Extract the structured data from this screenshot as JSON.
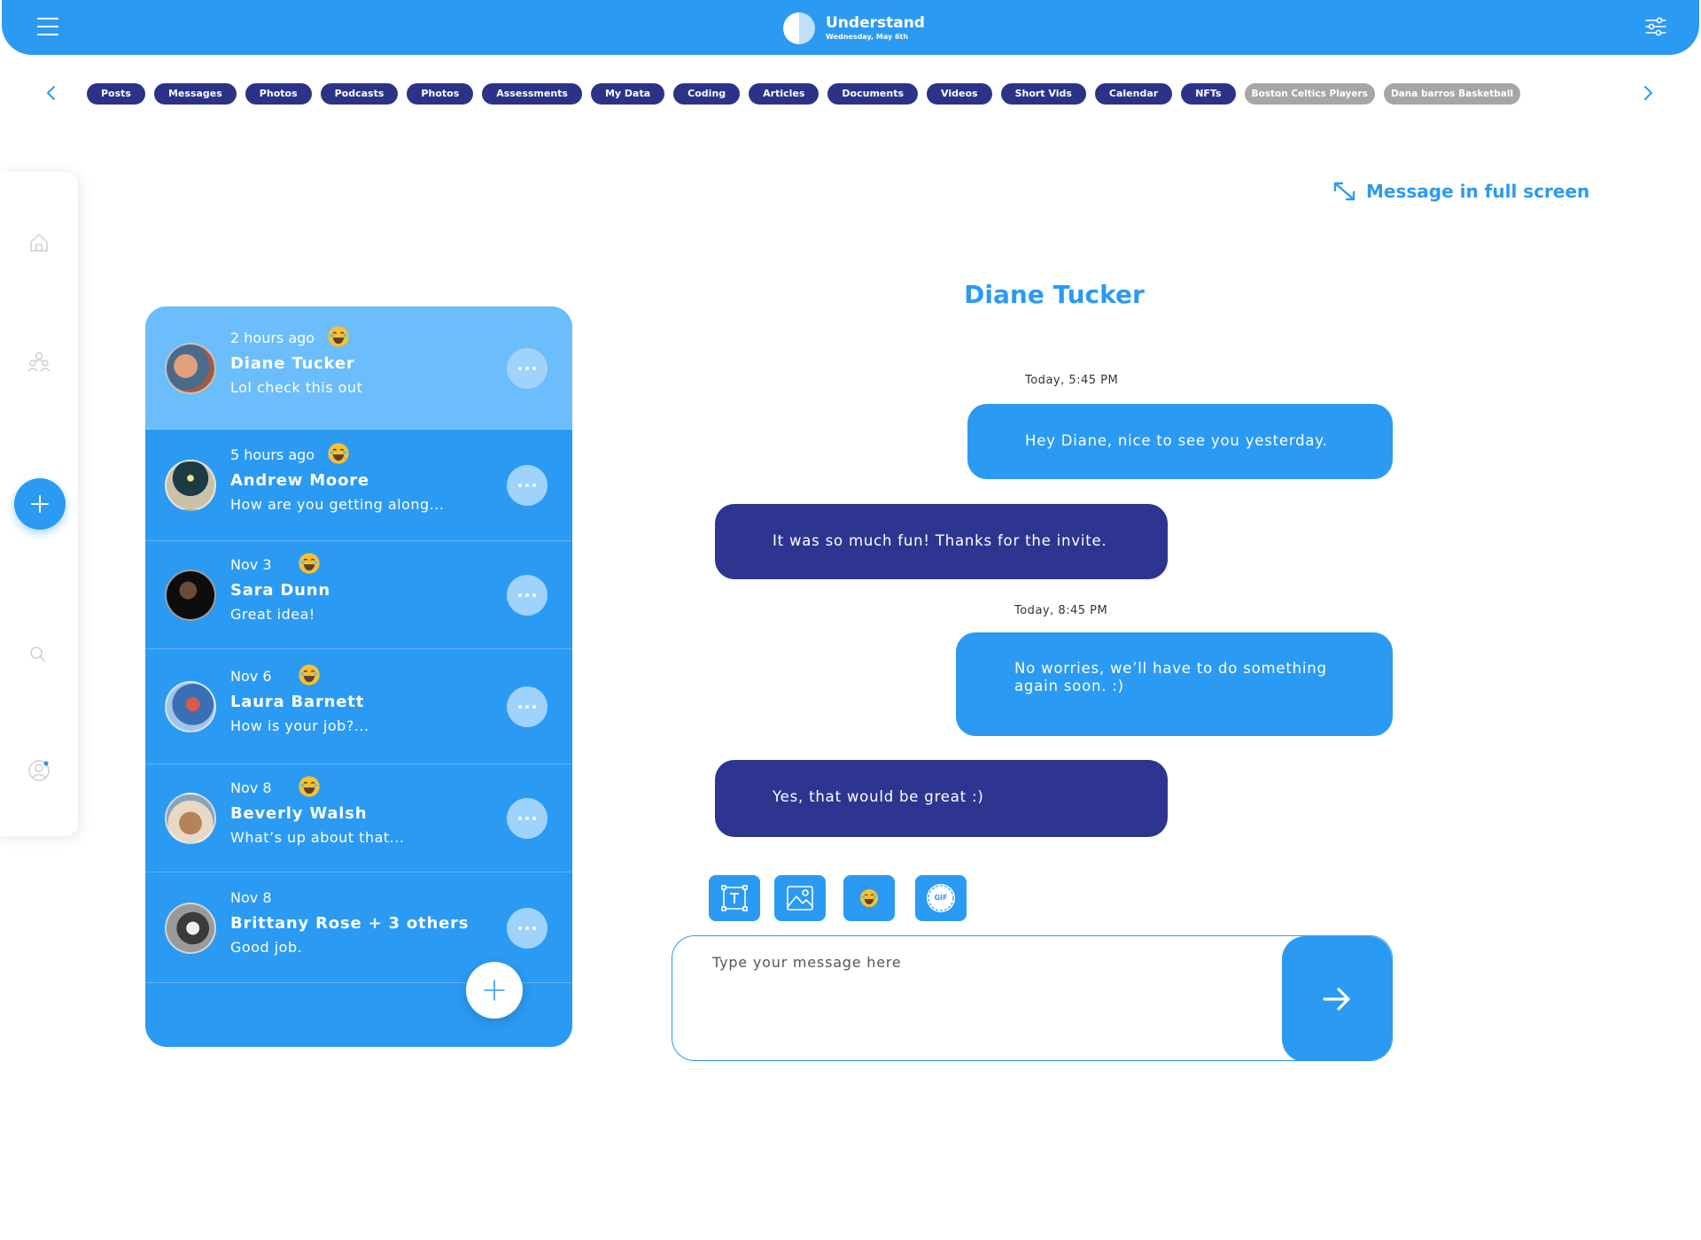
{
  "header": {
    "app_name": "Understand",
    "date": "Wednesday, May 6th",
    "icons": {
      "menu": "hamburger-icon",
      "settings": "sliders-icon",
      "logo": "half-circle-logo"
    }
  },
  "categories": {
    "prev_icon": "chevron-left-icon",
    "next_icon": "chevron-right-icon",
    "items": [
      {
        "label": "Posts",
        "muted": false
      },
      {
        "label": "Messages",
        "muted": false
      },
      {
        "label": "Photos",
        "muted": false
      },
      {
        "label": "Podcasts",
        "muted": false
      },
      {
        "label": "Photos",
        "muted": false
      },
      {
        "label": "Assessments",
        "muted": false
      },
      {
        "label": "My Data",
        "muted": false
      },
      {
        "label": "Coding",
        "muted": false
      },
      {
        "label": "Articles",
        "muted": false
      },
      {
        "label": "Documents",
        "muted": false
      },
      {
        "label": "Videos",
        "muted": false
      },
      {
        "label": "Short Vids",
        "muted": false
      },
      {
        "label": "Calendar",
        "muted": false
      },
      {
        "label": "NFTs",
        "muted": false
      },
      {
        "label": "Boston Celtics Players",
        "muted": true
      },
      {
        "label": "Dana barros Basketball",
        "muted": true
      }
    ]
  },
  "rail": {
    "icons": [
      "home-icon",
      "people-icon",
      "add-icon",
      "search-icon",
      "profile-icon"
    ]
  },
  "conversations": [
    {
      "time": "2 hours ago",
      "name": "Diane Tucker",
      "preview": "Lol check this out",
      "emoji": true,
      "active": true
    },
    {
      "time": "5 hours ago",
      "name": "Andrew Moore",
      "preview": "How are you getting along...",
      "emoji": true,
      "active": false
    },
    {
      "time": "Nov 3",
      "name": "Sara Dunn",
      "preview": "Great idea!",
      "emoji": true,
      "active": false
    },
    {
      "time": "Nov 6",
      "name": "Laura Barnett",
      "preview": "How is your job?...",
      "emoji": true,
      "active": false
    },
    {
      "time": "Nov 8",
      "name": "Beverly Walsh",
      "preview": "What’s up about that...",
      "emoji": true,
      "active": false
    },
    {
      "time": "Nov 8",
      "name": "Brittany Rose + 3 others",
      "preview": "Good job.",
      "emoji": false,
      "active": false
    }
  ],
  "chat": {
    "fullscreen_label": "Message in full screen",
    "contact_name": "Diane Tucker",
    "timestamps": [
      "Today, 5:45 PM",
      "Today, 8:45 PM"
    ],
    "messages": [
      {
        "direction": "out",
        "text": "Hey Diane, nice to see you yesterday."
      },
      {
        "direction": "in",
        "text": "It was so much fun! Thanks for the invite."
      },
      {
        "direction": "out",
        "text": "No worries, we’ll have to do something again soon. :)"
      },
      {
        "direction": "in",
        "text": "Yes, that would be great :)"
      }
    ],
    "tools": [
      "text-icon",
      "image-icon",
      "emoji-icon",
      "gif-icon"
    ],
    "gif_label": "GIF",
    "composer_placeholder": "Type your message here",
    "send_icon": "arrow-right-icon"
  },
  "colors": {
    "primary": "#2b9af3",
    "navy": "#2e3590",
    "active_row": "#6cbdfb",
    "muted_pill": "#a6a6a6"
  }
}
